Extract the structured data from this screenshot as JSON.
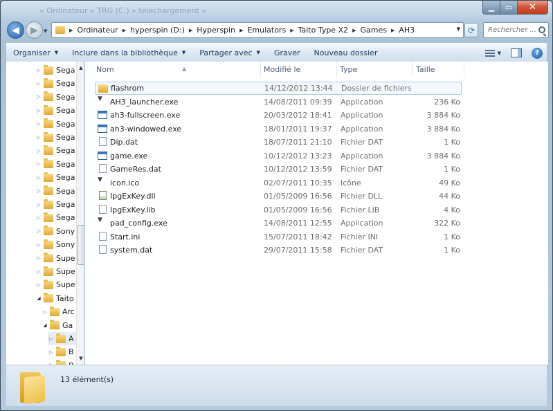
{
  "title_ghost": "« Ordinateur » TRG (C:) » telechargement »",
  "address": {
    "crumbs": [
      "Ordinateur",
      "hyperspin (D:)",
      "Hyperspin",
      "Emulators",
      "Taito Type X2",
      "Games",
      "AH3"
    ]
  },
  "search": {
    "placeholder": "Rechercher ..."
  },
  "toolbar": {
    "organize": "Organiser",
    "library": "Inclure dans la bibliothèque",
    "share": "Partager avec",
    "burn": "Graver",
    "new_folder": "Nouveau dossier"
  },
  "columns": {
    "name": "Nom",
    "modified": "Modifié le",
    "type": "Type",
    "size": "Taille"
  },
  "nav_items": [
    {
      "label": "Sega",
      "indent": 0
    },
    {
      "label": "Sega",
      "indent": 0
    },
    {
      "label": "Sega",
      "indent": 0
    },
    {
      "label": "Sega",
      "indent": 0
    },
    {
      "label": "Sega",
      "indent": 0
    },
    {
      "label": "Sega",
      "indent": 0
    },
    {
      "label": "Sega",
      "indent": 0
    },
    {
      "label": "Sega",
      "indent": 0
    },
    {
      "label": "Sega",
      "indent": 0
    },
    {
      "label": "Sega",
      "indent": 0
    },
    {
      "label": "Sega",
      "indent": 0
    },
    {
      "label": "Sega",
      "indent": 0
    },
    {
      "label": "Sony",
      "indent": 0
    },
    {
      "label": "Sony",
      "indent": 0
    },
    {
      "label": "Supe",
      "indent": 0
    },
    {
      "label": "Supe",
      "indent": 0
    },
    {
      "label": "Supe",
      "indent": 0
    },
    {
      "label": "Taito",
      "indent": 0
    },
    {
      "label": "Arc",
      "indent": 1
    },
    {
      "label": "Ga",
      "indent": 1
    },
    {
      "label": "A",
      "indent": 2
    },
    {
      "label": "B",
      "indent": 2
    },
    {
      "label": "B",
      "indent": 2
    }
  ],
  "files": [
    {
      "name": "flashrom",
      "date": "14/12/2012 13:44",
      "type": "Dossier de fichiers",
      "size": "",
      "icon": "folder"
    },
    {
      "name": "AH3_launcher.exe",
      "date": "14/08/2011 09:39",
      "type": "Application",
      "size": "236 Ko",
      "icon": "bird"
    },
    {
      "name": "ah3-fullscreen.exe",
      "date": "20/03/2012 18:41",
      "type": "Application",
      "size": "3 884 Ko",
      "icon": "app"
    },
    {
      "name": "ah3-windowed.exe",
      "date": "18/01/2011 19:37",
      "type": "Application",
      "size": "3 884 Ko",
      "icon": "app"
    },
    {
      "name": "Dip.dat",
      "date": "18/07/2011 21:10",
      "type": "Fichier DAT",
      "size": "1 Ko",
      "icon": "doc"
    },
    {
      "name": "game.exe",
      "date": "10/12/2012 13:23",
      "type": "Application",
      "size": "3 884 Ko",
      "icon": "app"
    },
    {
      "name": "GameRes.dat",
      "date": "10/12/2012 13:59",
      "type": "Fichier DAT",
      "size": "1 Ko",
      "icon": "doc"
    },
    {
      "name": "icon.ico",
      "date": "02/07/2011 10:35",
      "type": "Icône",
      "size": "49 Ko",
      "icon": "bird"
    },
    {
      "name": "IpgExKey.dll",
      "date": "01/05/2009 16:56",
      "type": "Fichier DLL",
      "size": "44 Ko",
      "icon": "dll"
    },
    {
      "name": "IpgExKey.lib",
      "date": "01/05/2009 16:56",
      "type": "Fichier LIB",
      "size": "4 Ko",
      "icon": "doc"
    },
    {
      "name": "pad_config.exe",
      "date": "14/08/2011 12:55",
      "type": "Application",
      "size": "322 Ko",
      "icon": "bird"
    },
    {
      "name": "Start.ini",
      "date": "15/07/2011 18:42",
      "type": "Fichier INI",
      "size": "1 Ko",
      "icon": "doc"
    },
    {
      "name": "system.dat",
      "date": "29/07/2011 15:58",
      "type": "Fichier DAT",
      "size": "1 Ko",
      "icon": "doc"
    }
  ],
  "status": {
    "count": "13 élément(s)"
  }
}
